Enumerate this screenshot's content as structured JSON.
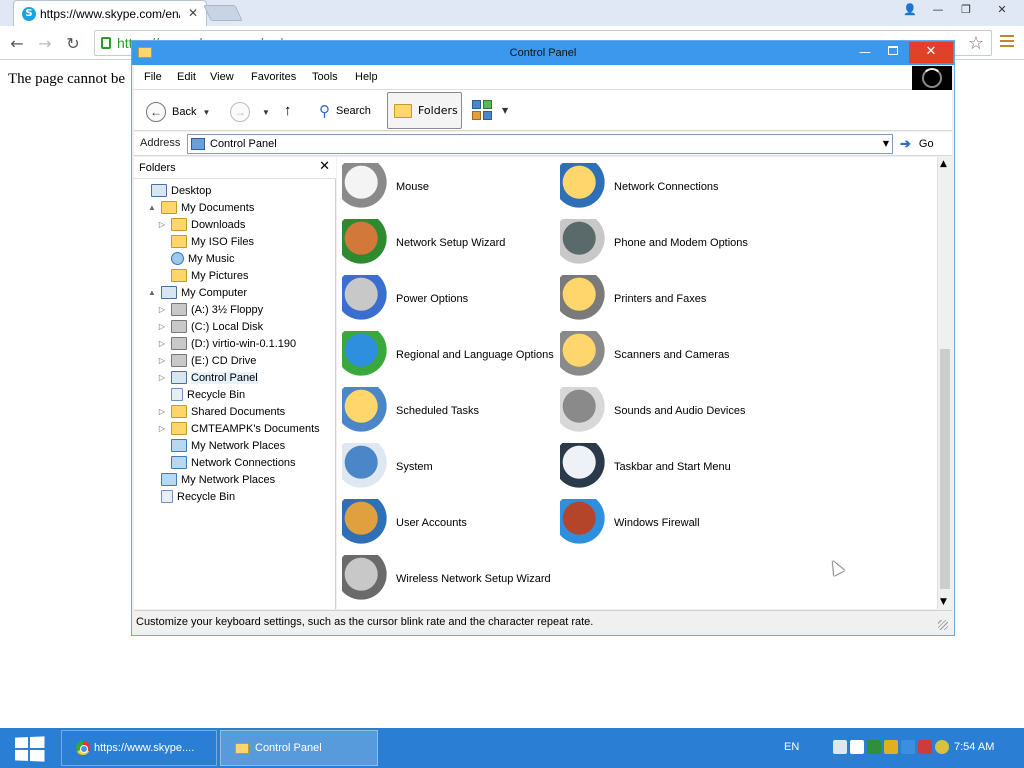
{
  "browser": {
    "tab_title": "https://www.skype.com/en/",
    "url": "https://www.skype.com/en/",
    "page_message": "The page cannot be",
    "colors": {
      "secure": "#2e9a2e",
      "tab_bg": "#dfe8f4"
    }
  },
  "window": {
    "title": "Control Panel",
    "colors": {
      "title_bar": "#3c98ec",
      "close": "#e0412a"
    }
  },
  "menu": [
    "File",
    "Edit",
    "View",
    "Favorites",
    "Tools",
    "Help"
  ],
  "toolbar": {
    "back_label": "Back",
    "search_label": "Search",
    "folders_label": "Folders"
  },
  "address": {
    "label": "Address",
    "value": "Control Panel",
    "go_label": "Go"
  },
  "folders_pane": {
    "header": "Folders",
    "tree": [
      {
        "label": "Desktop",
        "icon": "desktop-icon",
        "level": 0,
        "expander": ""
      },
      {
        "label": "My Documents",
        "icon": "folder-icon",
        "level": 1,
        "expander": "▲"
      },
      {
        "label": "Downloads",
        "icon": "folder-icon",
        "level": 2,
        "expander": "▷"
      },
      {
        "label": "My ISO Files",
        "icon": "folder-icon",
        "level": 2,
        "expander": ""
      },
      {
        "label": "My Music",
        "icon": "music-icon",
        "level": 2,
        "expander": ""
      },
      {
        "label": "My Pictures",
        "icon": "folder-icon",
        "level": 2,
        "expander": ""
      },
      {
        "label": "My Computer",
        "icon": "computer-icon",
        "level": 1,
        "expander": "▲"
      },
      {
        "label": "(A:) 3½ Floppy",
        "icon": "floppy-drive-icon",
        "level": 2,
        "expander": "▷"
      },
      {
        "label": "(C:) Local Disk",
        "icon": "local-disk-icon",
        "level": 2,
        "expander": "▷"
      },
      {
        "label": "(D:) virtio-win-0.1.190",
        "icon": "cd-drive-icon",
        "level": 2,
        "expander": "▷"
      },
      {
        "label": "(E:) CD Drive",
        "icon": "cd-drive-icon",
        "level": 2,
        "expander": "▷"
      },
      {
        "label": "Control Panel",
        "icon": "control-panel-icon",
        "level": 2,
        "expander": "▷"
      },
      {
        "label": "Recycle Bin",
        "icon": "recycle-bin-icon",
        "level": 2,
        "expander": ""
      },
      {
        "label": "Shared Documents",
        "icon": "folder-icon",
        "level": 2,
        "expander": "▷"
      },
      {
        "label": "CMTEAMPK's Documents",
        "icon": "folder-icon",
        "level": 2,
        "expander": "▷"
      },
      {
        "label": "My Network Places",
        "icon": "network-places-icon",
        "level": 2,
        "expander": ""
      },
      {
        "label": "Network Connections",
        "icon": "network-connections-icon",
        "level": 2,
        "expander": ""
      },
      {
        "label": "My Network Places",
        "icon": "network-places-icon",
        "level": 1,
        "expander": ""
      },
      {
        "label": "Recycle Bin",
        "icon": "recycle-bin-icon",
        "level": 1,
        "expander": ""
      }
    ]
  },
  "control_panel_items": [
    {
      "label": "Mouse",
      "icon": "mouse-icon"
    },
    {
      "label": "Network Connections",
      "icon": "network-connections-icon"
    },
    {
      "label": "Network Setup Wizard",
      "icon": "network-setup-wizard-icon"
    },
    {
      "label": "Phone and Modem Options",
      "icon": "phone-modem-icon"
    },
    {
      "label": "Power Options",
      "icon": "power-options-icon"
    },
    {
      "label": "Printers and Faxes",
      "icon": "printer-icon"
    },
    {
      "label": "Regional and Language Options",
      "icon": "globe-icon"
    },
    {
      "label": "Scanners and Cameras",
      "icon": "scanner-camera-icon"
    },
    {
      "label": "Scheduled Tasks",
      "icon": "scheduled-tasks-icon"
    },
    {
      "label": "Sounds and Audio Devices",
      "icon": "speaker-icon"
    },
    {
      "label": "System",
      "icon": "system-icon"
    },
    {
      "label": "Taskbar and Start Menu",
      "icon": "taskbar-start-menu-icon"
    },
    {
      "label": "User Accounts",
      "icon": "user-accounts-icon"
    },
    {
      "label": "Windows Firewall",
      "icon": "firewall-icon"
    },
    {
      "label": "Wireless Network Setup Wizard",
      "icon": "wireless-setup-icon"
    }
  ],
  "status": {
    "text": "Customize your keyboard settings, such as the cursor blink rate and the character repeat rate."
  },
  "taskbar": {
    "items": [
      "https://www.skype....",
      "Control Panel"
    ],
    "language": "EN",
    "time": "7:54 AM",
    "colors": {
      "bg": "#2a7fd4"
    }
  }
}
